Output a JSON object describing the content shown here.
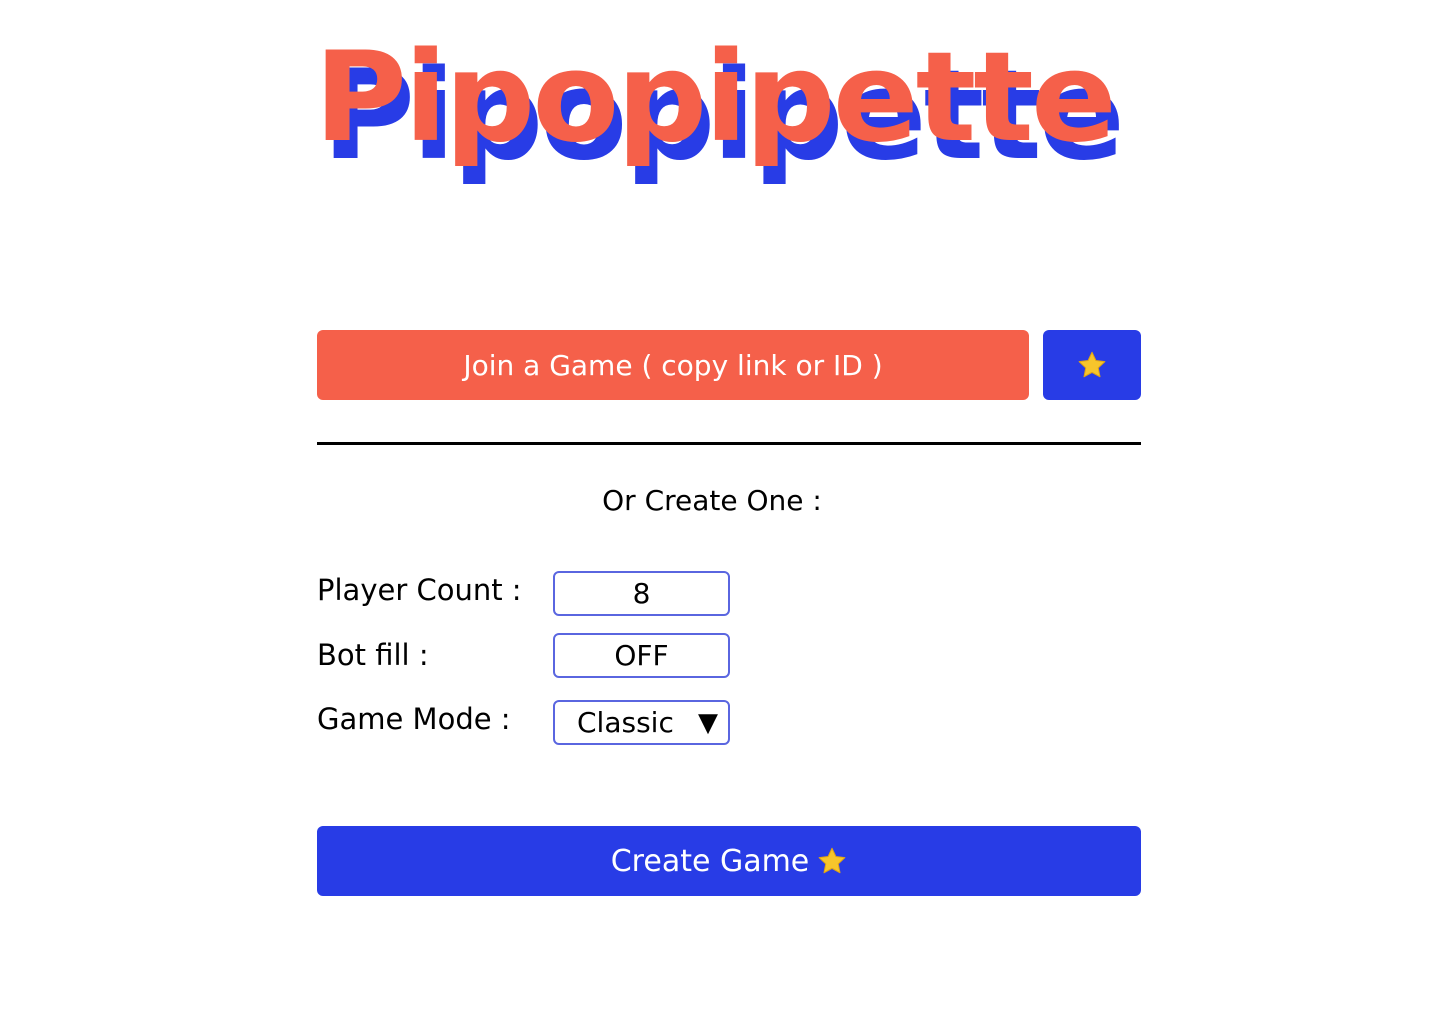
{
  "app": {
    "title": "Pipopipette"
  },
  "colors": {
    "accent_red": "#f5604a",
    "accent_blue": "#283ce6",
    "field_border": "#5a66e0",
    "star_yellow": "#f7c52b"
  },
  "join": {
    "label": "Join a Game ( copy link or ID )",
    "star_icon": "star-icon"
  },
  "create_section": {
    "heading": "Or Create One :",
    "player_count": {
      "label": "Player Count :",
      "value": "8"
    },
    "bot_fill": {
      "label": "Bot fill :",
      "value": "OFF"
    },
    "game_mode": {
      "label": "Game Mode :",
      "value": "Classic",
      "caret": "▼"
    },
    "create_button": {
      "label": "Create Game",
      "icon": "star-icon"
    }
  }
}
